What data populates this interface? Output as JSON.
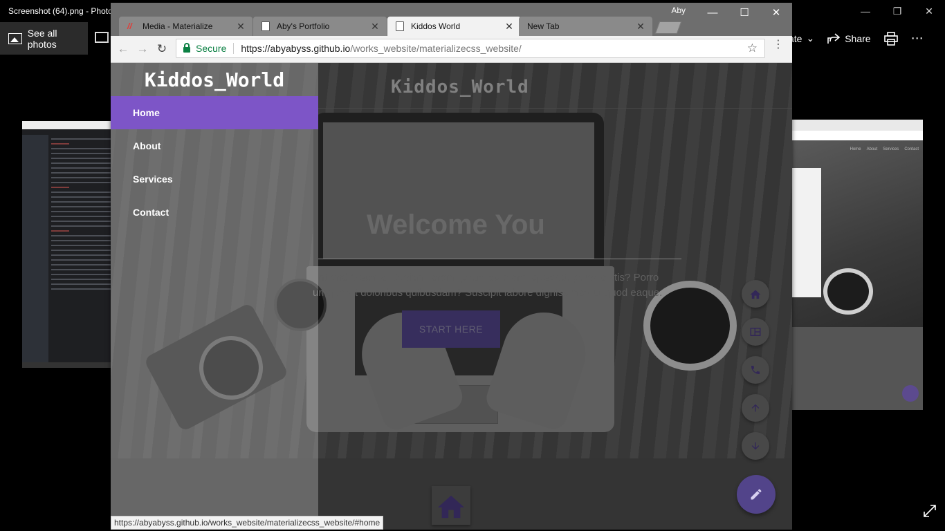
{
  "photos_app": {
    "title": "Screenshot (64).png - Photo",
    "see_all": "See all photos",
    "toolbar": {
      "partial_label": "ate",
      "share": "Share"
    }
  },
  "browser": {
    "profile": "Aby",
    "tabs": [
      {
        "title": "Media - Materialize",
        "favicon": "materialize-logo",
        "active": false
      },
      {
        "title": "Aby's Portfolio",
        "favicon": "document-icon",
        "active": false
      },
      {
        "title": "Kiddos World",
        "favicon": "document-icon",
        "active": true
      },
      {
        "title": "New Tab",
        "favicon": "none",
        "active": false
      }
    ],
    "secure_label": "Secure",
    "url_host": "https://abyabyss.github.io",
    "url_path": "/works_website/materializecss_website/",
    "status_url": "https://abyabyss.github.io/works_website/materializecss_website/#home"
  },
  "page": {
    "brand": "Kiddos_World",
    "sidenav": {
      "brand": "Kiddos_World",
      "items": [
        {
          "label": "Home",
          "active": true
        },
        {
          "label": "About",
          "active": false
        },
        {
          "label": "Services",
          "active": false
        },
        {
          "label": "Contact",
          "active": false
        }
      ]
    },
    "hero": {
      "heading": "Welcome You",
      "text_line1": "ont-end Material Design Lorem ipsum dolo ore, quaerat, perspiciatis? Porro",
      "text_line2": "umque sit doloribus quibusdam? Suscipit labore dignissimos ut quod eaque.",
      "button": "START HERE"
    },
    "fab_buttons": [
      "home-icon",
      "web-icon",
      "phone-icon",
      "arrow-up-icon",
      "arrow-down-icon"
    ],
    "fab_main": "edit-icon",
    "accent_color": "#7d55c7"
  }
}
